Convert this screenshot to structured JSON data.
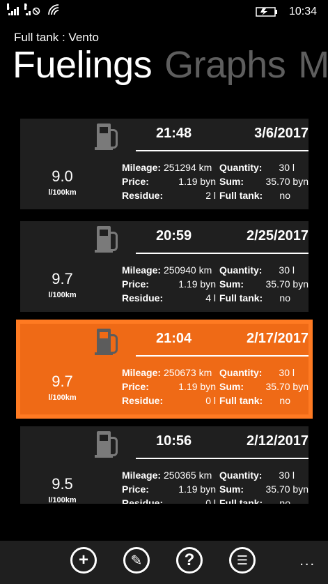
{
  "status": {
    "sim1": "1",
    "sim2": "2",
    "time": "10:34"
  },
  "app_title": "Full tank : Vento",
  "pivot": [
    "Fuelings",
    "Graphs",
    "M"
  ],
  "labels": {
    "mileage": "Mileage:",
    "quantity": "Quantity:",
    "price": "Price:",
    "sum": "Sum:",
    "residue": "Residue:",
    "full_tank": "Full tank:",
    "unit": "l/100km"
  },
  "fuelings": [
    {
      "time": "21:48",
      "date": "3/6/2017",
      "consumption": "9.0",
      "mileage": "251294 km",
      "quantity": "30 l",
      "price": "1.19 byn",
      "sum": "35.70 byn",
      "residue": "2 l",
      "full_tank": "no",
      "selected": false
    },
    {
      "time": "20:59",
      "date": "2/25/2017",
      "consumption": "9.7",
      "mileage": "250940 km",
      "quantity": "30 l",
      "price": "1.19 byn",
      "sum": "35.70 byn",
      "residue": "4 l",
      "full_tank": "no",
      "selected": false
    },
    {
      "time": "21:04",
      "date": "2/17/2017",
      "consumption": "9.7",
      "mileage": "250673 km",
      "quantity": "30 l",
      "price": "1.19 byn",
      "sum": "35.70 byn",
      "residue": "0 l",
      "full_tank": "no",
      "selected": true
    },
    {
      "time": "10:56",
      "date": "2/12/2017",
      "consumption": "9.5",
      "mileage": "250365 km",
      "quantity": "30 l",
      "price": "1.19 byn",
      "sum": "35.70 byn",
      "residue": "0 l",
      "full_tank": "no",
      "selected": false
    }
  ],
  "appbar": {
    "buttons": [
      {
        "icon": "add-icon",
        "glyph": "+"
      },
      {
        "icon": "edit-icon",
        "glyph": "✎"
      },
      {
        "icon": "help-icon",
        "glyph": "?"
      },
      {
        "icon": "list-icon",
        "glyph": "☰"
      }
    ],
    "more": "..."
  },
  "colors": {
    "accent": "#ef6a16",
    "card": "#1f1f1f",
    "background": "#000000"
  }
}
